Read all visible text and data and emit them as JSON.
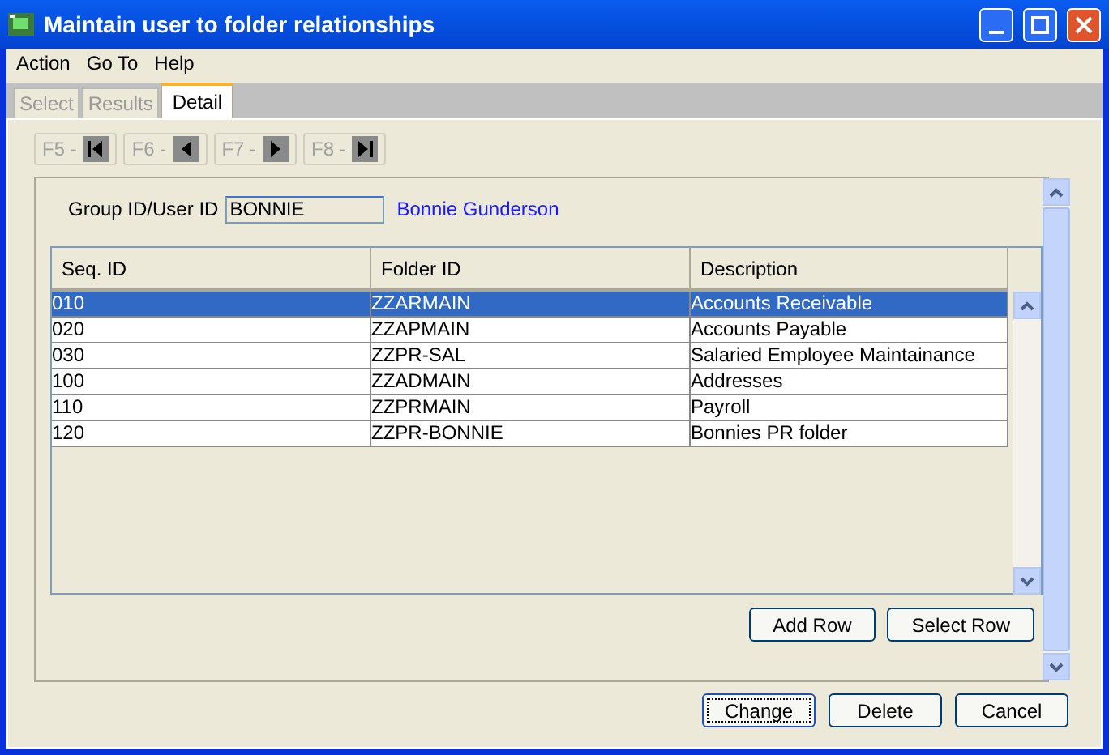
{
  "window": {
    "title": "Maintain user to folder relationships"
  },
  "menu": [
    "Action",
    "Go To",
    "Help"
  ],
  "tabs": [
    {
      "label": "Select",
      "selected": false
    },
    {
      "label": "Results",
      "selected": false
    },
    {
      "label": "Detail",
      "selected": true
    }
  ],
  "nav_buttons": [
    {
      "label": "F5 -",
      "kind": "first"
    },
    {
      "label": "F6 -",
      "kind": "prev"
    },
    {
      "label": "F7 -",
      "kind": "next"
    },
    {
      "label": "F8 -",
      "kind": "last"
    }
  ],
  "user_field": {
    "label": "Group ID/User ID",
    "value": "BONNIE",
    "name": "Bonnie Gunderson"
  },
  "table": {
    "columns": [
      "Seq. ID",
      "Folder ID",
      "Description"
    ],
    "rows": [
      {
        "cells": [
          "010",
          "ZZARMAIN",
          "Accounts Receivable"
        ],
        "selected": true
      },
      {
        "cells": [
          "020",
          "ZZAPMAIN",
          "Accounts Payable"
        ],
        "selected": false
      },
      {
        "cells": [
          "030",
          "ZZPR-SAL",
          "Salaried Employee Maintainance"
        ],
        "selected": false
      },
      {
        "cells": [
          "100",
          "ZZADMAIN",
          "Addresses"
        ],
        "selected": false
      },
      {
        "cells": [
          "110",
          "ZZPRMAIN",
          "Payroll"
        ],
        "selected": false
      },
      {
        "cells": [
          "120",
          "ZZPR-BONNIE",
          "Bonnies PR folder"
        ],
        "selected": false
      }
    ]
  },
  "table_buttons": [
    "Add Row",
    "Select Row"
  ],
  "footer_buttons": [
    {
      "label": "Change",
      "focused": true
    },
    {
      "label": "Delete",
      "focused": false
    },
    {
      "label": "Cancel",
      "focused": false
    }
  ]
}
